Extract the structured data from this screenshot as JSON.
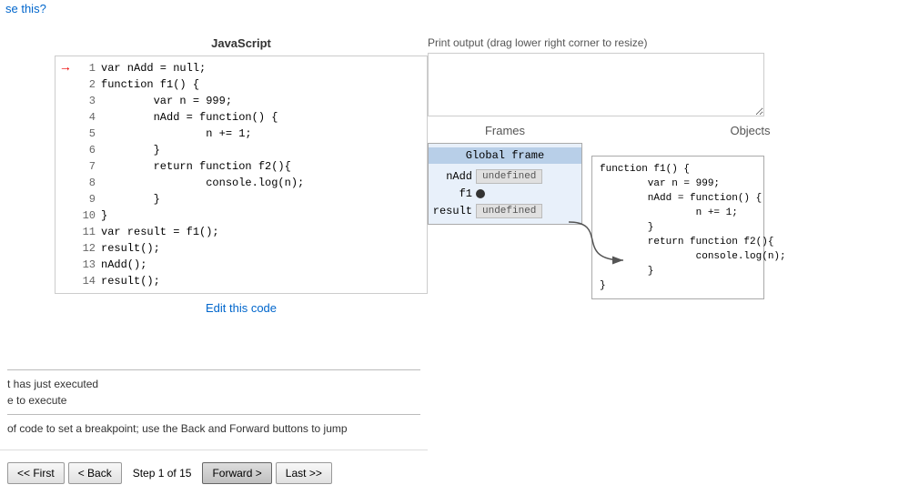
{
  "topLink": {
    "label": "se this?",
    "href": "#"
  },
  "codePanel": {
    "title": "JavaScript",
    "lines": [
      {
        "num": 1,
        "code": "var nAdd = null;",
        "current": true
      },
      {
        "num": 2,
        "code": "function f1() {"
      },
      {
        "num": 3,
        "code": "        var n = 999;"
      },
      {
        "num": 4,
        "code": "        nAdd = function() {"
      },
      {
        "num": 5,
        "code": "                n += 1;"
      },
      {
        "num": 6,
        "code": "        }"
      },
      {
        "num": 7,
        "code": "        return function f2(){"
      },
      {
        "num": 8,
        "code": "                console.log(n);"
      },
      {
        "num": 9,
        "code": "        }"
      },
      {
        "num": 10,
        "code": "}"
      },
      {
        "num": 11,
        "code": "var result = f1();"
      },
      {
        "num": 12,
        "code": "result();"
      },
      {
        "num": 13,
        "code": "nAdd();"
      },
      {
        "num": 14,
        "code": "result();"
      }
    ],
    "editLabel": "Edit this code"
  },
  "infoSection": {
    "line1": "t has just executed",
    "line2": "e to execute",
    "line3": "of code to set a breakpoint; use the Back and Forward buttons to jump"
  },
  "navBar": {
    "firstLabel": "<< First",
    "backLabel": "< Back",
    "stepLabel": "Step 1 of 15",
    "forwardLabel": "Forward >",
    "lastLabel": "Last >>"
  },
  "rightPanel": {
    "printLabel": "Print output (drag lower right corner to resize)",
    "framesHeader": "Frames",
    "objectsHeader": "Objects",
    "globalFrame": {
      "title": "Global frame",
      "rows": [
        {
          "var": "nAdd",
          "val": "undefined",
          "hasArrow": false
        },
        {
          "var": "f1",
          "val": "",
          "hasArrow": true
        },
        {
          "var": "result",
          "val": "undefined",
          "hasArrow": false
        }
      ]
    },
    "objectCode": "function f1() {\n        var n = 999;\n        nAdd = function() {\n                n += 1;\n        }\n        return function f2(){\n                console.log(n);\n        }\n}"
  }
}
